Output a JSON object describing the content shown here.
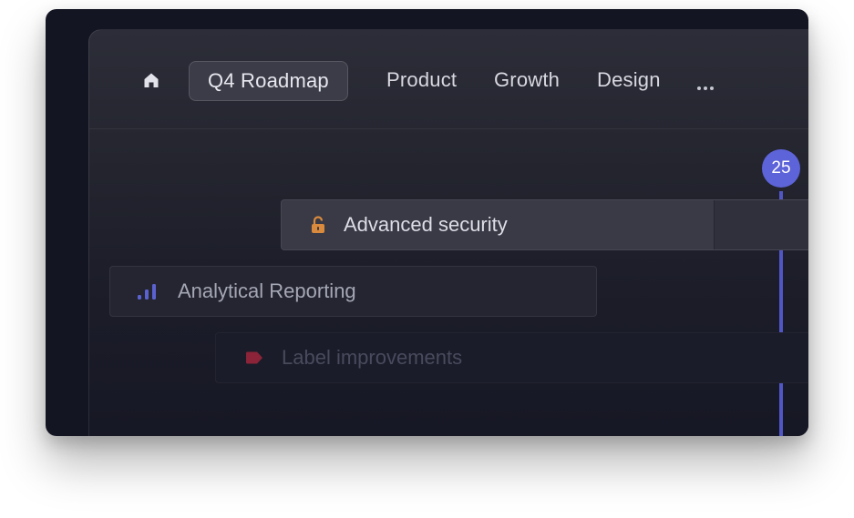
{
  "colors": {
    "accent": "#5d63d8",
    "lock_icon": "#d98a3c",
    "reporting_icon": "#5b62d0",
    "label_icon": "#8b2438"
  },
  "nav": {
    "home_icon": "home-icon",
    "tabs": [
      {
        "label": "Q4 Roadmap",
        "active": true
      },
      {
        "label": "Product",
        "active": false
      },
      {
        "label": "Growth",
        "active": false
      },
      {
        "label": "Design",
        "active": false
      }
    ],
    "more_icon": "ellipsis-icon"
  },
  "timeline": {
    "today_marker": "25"
  },
  "items": [
    {
      "label": "Advanced security",
      "icon": "lock-icon"
    },
    {
      "label": "Analytical Reporting",
      "icon": "bar-chart-icon"
    },
    {
      "label": "Label improvements",
      "icon": "tag-icon"
    }
  ]
}
